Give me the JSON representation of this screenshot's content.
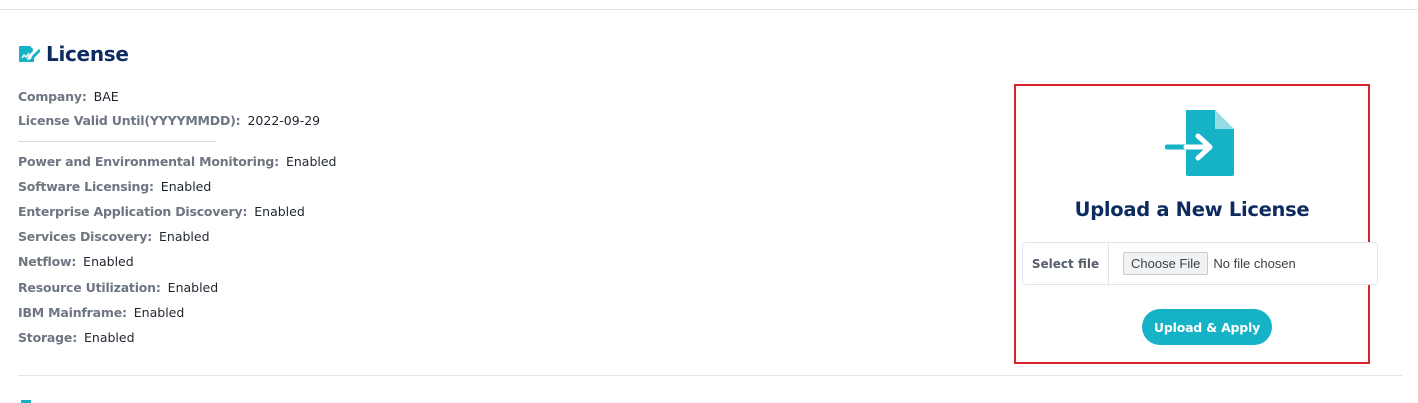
{
  "license": {
    "title": "License",
    "company_label": "Company:",
    "company_value": "BAE",
    "valid_label": "License Valid Until(YYYYMMDD):",
    "valid_value": "2022-09-29",
    "features": [
      {
        "label": "Power and Environmental Monitoring:",
        "value": "Enabled"
      },
      {
        "label": "Software Licensing:",
        "value": "Enabled"
      },
      {
        "label": "Enterprise Application Discovery:",
        "value": "Enabled"
      },
      {
        "label": "Services Discovery:",
        "value": "Enabled"
      },
      {
        "label": "Netflow:",
        "value": "Enabled"
      },
      {
        "label": "Resource Utilization:",
        "value": "Enabled"
      },
      {
        "label": "IBM Mainframe:",
        "value": "Enabled"
      },
      {
        "label": "Storage:",
        "value": "Enabled"
      }
    ]
  },
  "upload": {
    "title": "Upload a New License",
    "select_file_label": "Select file",
    "choose_file_label": "Choose File",
    "no_file_text": "No file chosen",
    "apply_button": "Upload & Apply"
  },
  "icons": {
    "section": "license-edit-icon",
    "upload": "file-import-icon"
  },
  "colors": {
    "accent": "#16b2c6",
    "heading": "#0d2b5e",
    "highlight_border": "#d9232a"
  }
}
